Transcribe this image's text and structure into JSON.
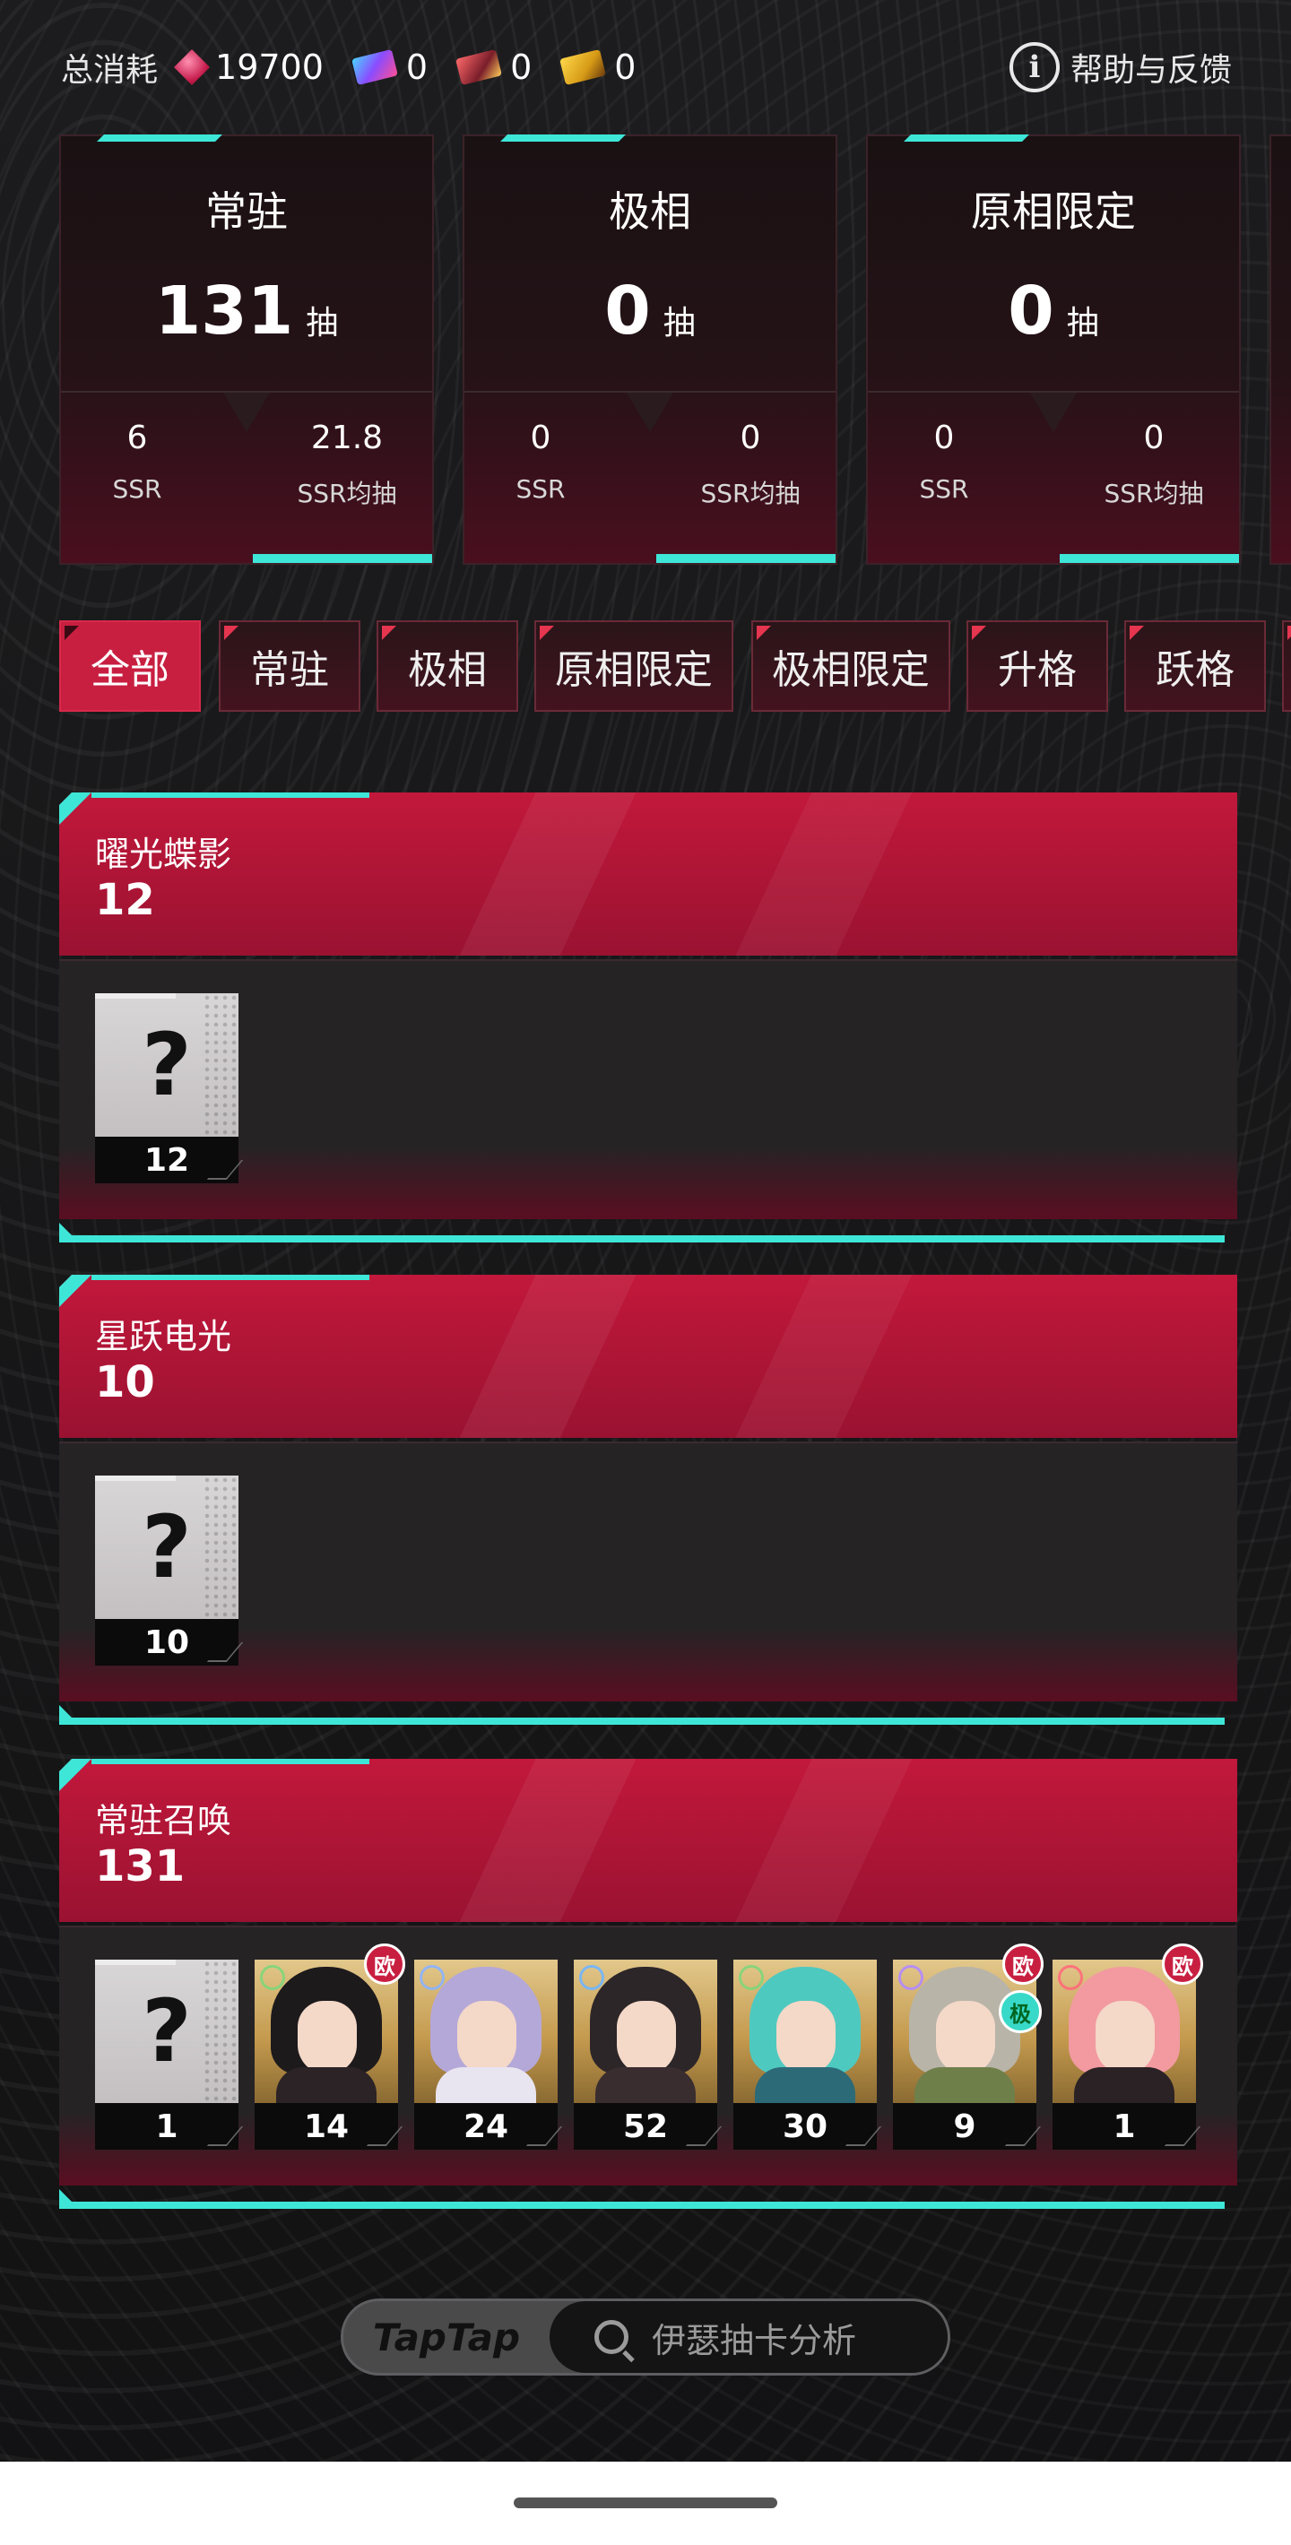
{
  "header": {
    "consume_label": "总消耗",
    "currencies": [
      {
        "icon": "gem-icon",
        "value": "19700"
      },
      {
        "icon": "ticket-blue-icon",
        "value": "0"
      },
      {
        "icon": "ticket-red-icon",
        "value": "0"
      },
      {
        "icon": "ticket-gold-icon",
        "value": "0"
      }
    ],
    "help_label": "帮助与反馈"
  },
  "stats": [
    {
      "title": "常驻",
      "pulls": "131",
      "unit": "抽",
      "ssr": "6",
      "ssr_label": "SSR",
      "avg": "21.8",
      "avg_label": "SSR均抽"
    },
    {
      "title": "极相",
      "pulls": "0",
      "unit": "抽",
      "ssr": "0",
      "ssr_label": "SSR",
      "avg": "0",
      "avg_label": "SSR均抽"
    },
    {
      "title": "原相限定",
      "pulls": "0",
      "unit": "抽",
      "ssr": "0",
      "ssr_label": "SSR",
      "avg": "0",
      "avg_label": "SSR均抽"
    }
  ],
  "tabs": [
    "全部",
    "常驻",
    "极相",
    "原相限定",
    "极相限定",
    "升格",
    "跃格"
  ],
  "active_tab": "全部",
  "pools": [
    {
      "name": "曜光蝶影",
      "count": "12",
      "chars": [
        {
          "label": "?",
          "count": "12"
        }
      ]
    },
    {
      "name": "星跃电光",
      "count": "10",
      "chars": [
        {
          "label": "?",
          "count": "10"
        }
      ]
    },
    {
      "name": "常驻召唤",
      "count": "131",
      "chars": [
        {
          "label": "?",
          "count": "1"
        },
        {
          "count": "14",
          "badge": "欧"
        },
        {
          "count": "24"
        },
        {
          "count": "52"
        },
        {
          "count": "30"
        },
        {
          "count": "9",
          "badge": "欧",
          "badge2": "极"
        },
        {
          "count": "1",
          "badge": "欧"
        }
      ]
    }
  ],
  "footer": {
    "brand": "TapTap",
    "search_text": "伊瑟抽卡分析"
  },
  "colors": {
    "accent": "#c81f41",
    "teal": "#3ee6d8",
    "background": "#161617"
  }
}
